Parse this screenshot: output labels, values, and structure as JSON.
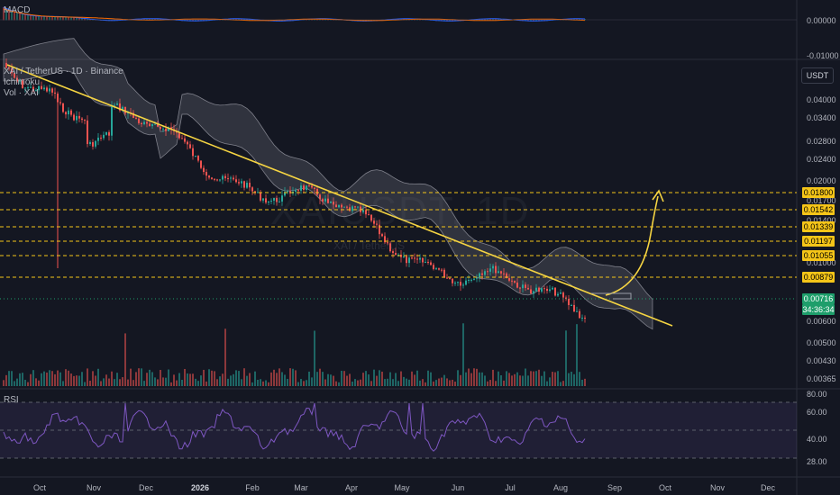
{
  "panels": {
    "macd": {
      "title": "MACD"
    },
    "main": {
      "symbol": "XAI / TetherUS · 1D · Binance",
      "ichimoku": "Ichimoku",
      "vol": "Vol · XAI",
      "watermark": "XAIUSDT, 1D",
      "sub_watermark": "XAI / TetherUS"
    },
    "rsi": {
      "title": "RSI"
    }
  },
  "currency_button": "USDT",
  "right_axis": {
    "macd_ticks": [
      "0.00000",
      "-0.01000"
    ],
    "price_ticks": [
      "0.04000",
      "0.03400",
      "0.02800",
      "0.02400",
      "0.02000",
      "0.01700",
      "0.01400",
      "0.01000",
      "0.00600",
      "0.00500",
      "0.00430",
      "0.00365"
    ],
    "rsi_ticks": [
      "80.00",
      "60.00",
      "40.00",
      "28.00"
    ]
  },
  "badges": [
    {
      "text": "0.01800",
      "kind": "y"
    },
    {
      "text": "0.01542",
      "kind": "y"
    },
    {
      "text": "0.01339",
      "kind": "y"
    },
    {
      "text": "0.01197",
      "kind": "y"
    },
    {
      "text": "0.01055",
      "kind": "y"
    },
    {
      "text": "0.00879",
      "kind": "y"
    },
    {
      "text": "0.00716",
      "kind": "g"
    },
    {
      "text": "34:36:34",
      "kind": "g"
    }
  ],
  "months": [
    "Oct",
    "Nov",
    "Dec",
    "2026",
    "Feb",
    "Mar",
    "Apr",
    "May",
    "Jun",
    "Jul",
    "Aug",
    "Sep",
    "Oct",
    "Nov",
    "Dec"
  ],
  "colors": {
    "bg": "#141722",
    "up": "#26a69a",
    "down": "#ef5350",
    "trend": "#f5d442",
    "level": "#f5c518",
    "macd": "#2962ff",
    "signal": "#ff6d00",
    "rsi": "#7e57c2"
  }
}
